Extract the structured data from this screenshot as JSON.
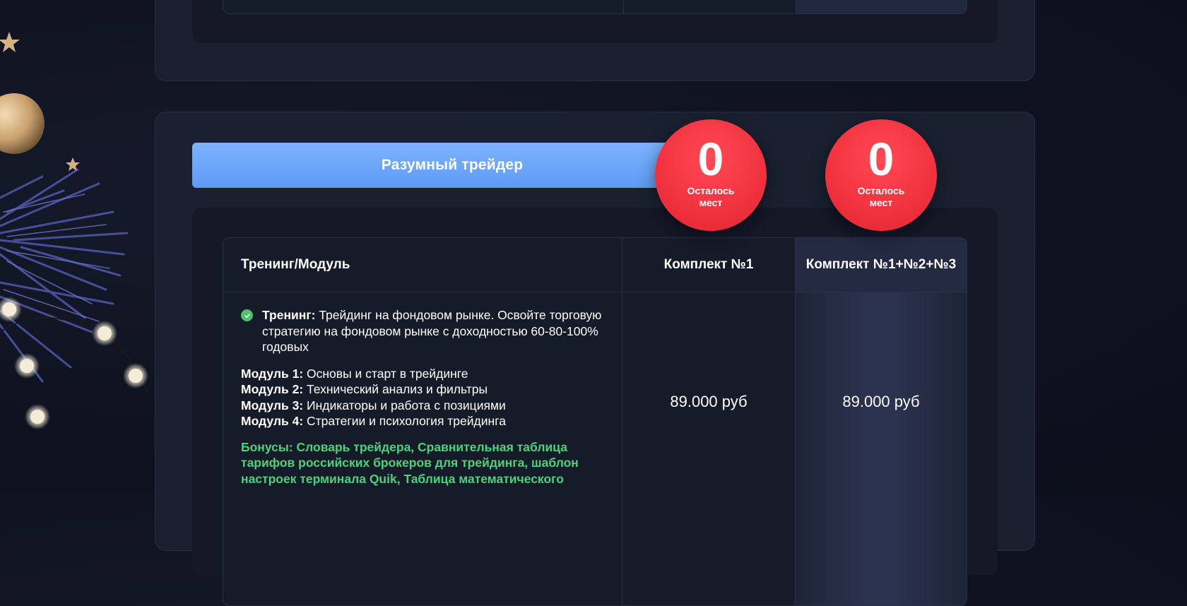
{
  "plan": {
    "title": "Разумный трейдер",
    "badges": [
      {
        "count": "0",
        "label_line1": "Осталось",
        "label_line2": "мест"
      },
      {
        "count": "0",
        "label_line1": "Осталось",
        "label_line2": "мест"
      }
    ]
  },
  "table": {
    "headers": [
      "Тренинг/Модуль",
      "Комплект №1",
      "Комплект №1+№2+№3"
    ],
    "training": {
      "label": "Тренинг:",
      "text": " Трейдинг на фондовом рынке. Освойте торговую стратегию на фондовом рынке с доходностью 60-80-100% годовых"
    },
    "modules": [
      {
        "label": "Модуль 1:",
        "text": " Основы и старт в трейдинге"
      },
      {
        "label": "Модуль 2:",
        "text": " Технический анализ и фильтры"
      },
      {
        "label": "Модуль 3:",
        "text": " Индикаторы и работа с позициями"
      },
      {
        "label": "Модуль 4:",
        "text": " Стратегии и психология трейдинга"
      }
    ],
    "bonus": "Бонусы: Словарь трейдера, Сравнительная таблица тарифов российских брокеров для трейдинга, шаблон настроек терминала Quik, Таблица математического",
    "prices": [
      "89.000 руб",
      "89.000 руб"
    ]
  },
  "colors": {
    "accent_blue": "#6aa6f8",
    "badge_red": "#f0323e",
    "bonus_green": "#4dd17a",
    "check_green": "#4bc16b",
    "background": "#0f1320"
  },
  "icons": [
    "check-circle-icon",
    "star-icon",
    "ornament-ball-icon",
    "string-light-icon",
    "pine-branch-icon"
  ]
}
